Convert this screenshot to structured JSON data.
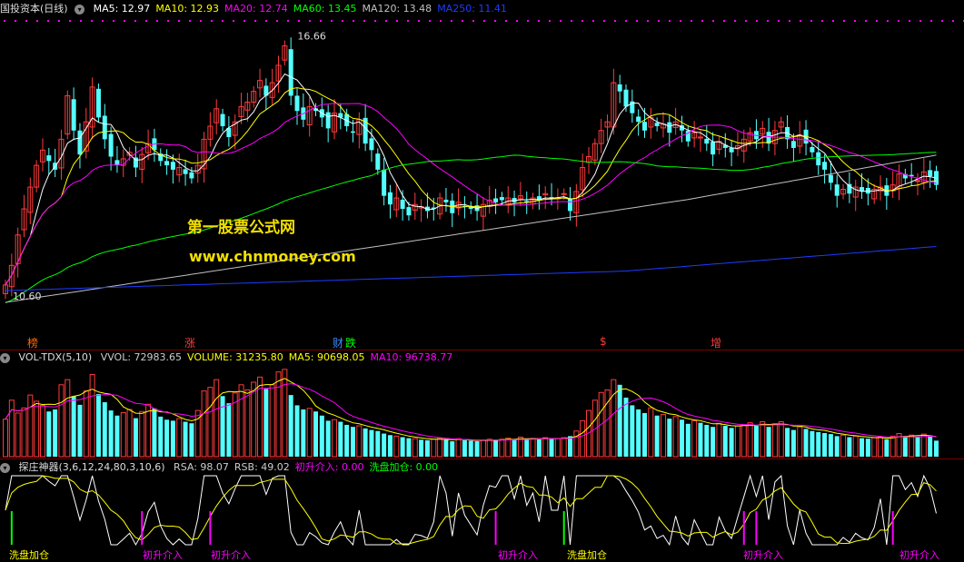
{
  "colors": {
    "bg": "#000000",
    "up": "#ff3b3b",
    "down": "#54ffff",
    "ma5": "#ffffff",
    "ma10": "#ffff00",
    "ma20": "#ff00ff",
    "ma60": "#00ff00",
    "ma120": "#c0c0c0",
    "ma250": "#1e3cff",
    "rsa": "#ffffff",
    "rsb": "#ffff00"
  },
  "price_panel": {
    "icon": "settings-icon",
    "title": "国投资本(日线)",
    "ma": [
      {
        "label": "MA5: 12.97",
        "color": "#ffffff"
      },
      {
        "label": "MA10: 12.93",
        "color": "#ffff00"
      },
      {
        "label": "MA20: 12.74",
        "color": "#ff00ff"
      },
      {
        "label": "MA60: 13.45",
        "color": "#00ff00"
      },
      {
        "label": "MA120: 13.48",
        "color": "#c0c0c0"
      },
      {
        "label": "MA250: 11.41",
        "color": "#1e3cff"
      }
    ],
    "high_label": "16.66",
    "low_label": "10.60",
    "watermark_title": "第一股票公式网",
    "watermark_url": "www.chnmoney.com",
    "event_markers": [
      {
        "text": "榜",
        "color": "#ff6a00"
      },
      {
        "text": "涨",
        "color": "#ff3b3b"
      },
      {
        "text": "财",
        "color": "#3c8cff"
      },
      {
        "text": "跌",
        "color": "#00ff00"
      },
      {
        "text": "$",
        "color": "#ff3b3b"
      },
      {
        "text": "增",
        "color": "#ff3b3b"
      }
    ]
  },
  "volume_panel": {
    "icon": "settings-icon",
    "title": "VOL-TDX(5,10)",
    "values": [
      {
        "label": "VVOL: 72983.65",
        "color": "#cccccc"
      },
      {
        "label": "VOLUME: 31235.80",
        "color": "#ffff00"
      },
      {
        "label": "MA5: 90698.05",
        "color": "#ffff00"
      },
      {
        "label": "MA10: 96738.77",
        "color": "#ff00ff"
      }
    ]
  },
  "indicator_panel": {
    "icon": "settings-icon",
    "title": "探庄神器(3,6,12,24,80,3,10,6)",
    "values": [
      {
        "label": "RSA: 98.07",
        "color": "#cccccc"
      },
      {
        "label": "RSB: 49.02",
        "color": "#cccccc"
      },
      {
        "label": "初升介入: 0.00",
        "color": "#ff00ff"
      },
      {
        "label": "洗盘加仓: 0.00",
        "color": "#00ff00"
      }
    ],
    "signal_labels": [
      {
        "text": "洗盘加仓",
        "color": "#ffff00"
      },
      {
        "text": "初升介入",
        "color": "#ff00ff"
      },
      {
        "text": "初升介入",
        "color": "#ff00ff"
      },
      {
        "text": "初升介入",
        "color": "#ff00ff"
      },
      {
        "text": "洗盘加仓",
        "color": "#ffff00"
      },
      {
        "text": "初升介入",
        "color": "#ff00ff"
      },
      {
        "text": "初升介入",
        "color": "#ff00ff"
      }
    ]
  },
  "chart_data": {
    "type": "candlestick",
    "title": "国投资本(日线)",
    "ylim": [
      10.6,
      16.66
    ],
    "series": [
      {
        "name": "MA5",
        "last": 12.97
      },
      {
        "name": "MA10",
        "last": 12.93
      },
      {
        "name": "MA20",
        "last": 12.74
      },
      {
        "name": "MA60",
        "last": 13.45
      },
      {
        "name": "MA120",
        "last": 13.48
      },
      {
        "name": "MA250",
        "last": 11.41
      }
    ],
    "close": [
      10.85,
      11.3,
      12.0,
      12.6,
      13.1,
      13.6,
      13.95,
      13.7,
      13.5,
      14.2,
      15.2,
      14.4,
      13.85,
      14.6,
      15.4,
      14.7,
      14.2,
      13.8,
      13.6,
      13.75,
      13.9,
      13.55,
      13.85,
      14.1,
      13.95,
      13.7,
      13.6,
      13.5,
      13.55,
      13.4,
      13.3,
      13.6,
      14.2,
      14.5,
      14.9,
      14.5,
      14.25,
      14.6,
      14.95,
      15.05,
      15.3,
      15.55,
      15.2,
      15.5,
      15.9,
      16.35,
      15.2,
      14.85,
      14.65,
      14.95,
      14.85,
      14.7,
      14.45,
      14.8,
      14.7,
      14.5,
      14.35,
      14.65,
      14.1,
      13.95,
      13.5,
      12.9,
      12.7,
      12.85,
      12.6,
      12.45,
      12.7,
      12.65,
      12.55,
      12.6,
      12.85,
      12.75,
      12.5,
      12.75,
      12.65,
      12.6,
      12.55,
      12.7,
      12.8,
      12.75,
      12.8,
      12.85,
      12.75,
      12.9,
      12.75,
      12.85,
      12.8,
      12.95,
      12.85,
      12.85,
      12.95,
      12.55,
      13.0,
      13.55,
      13.8,
      14.1,
      14.4,
      14.6,
      15.5,
      15.3,
      14.95,
      14.8,
      14.6,
      14.4,
      14.7,
      14.5,
      14.55,
      14.35,
      14.6,
      14.4,
      14.15,
      14.35,
      14.25,
      14.1,
      13.85,
      14.15,
      14.0,
      13.9,
      14.05,
      14.2,
      14.35,
      14.2,
      14.45,
      14.1,
      14.4,
      14.6,
      14.2,
      14.0,
      14.3,
      14.1,
      13.9,
      13.6,
      13.5,
      13.2,
      12.9,
      13.05,
      12.95,
      13.1,
      13.0,
      12.95,
      13.05,
      13.1,
      12.9,
      13.15,
      13.4,
      13.3,
      13.35,
      13.25,
      13.45,
      13.35,
      13.15
    ],
    "volume": [
      72983.65,
      110000,
      85000,
      95000,
      120000,
      108000,
      100000,
      88000,
      92000,
      140000,
      150000,
      118000,
      101000,
      128000,
      160000,
      122000,
      106000,
      90000,
      80000,
      86000,
      92000,
      75000,
      88000,
      102000,
      94000,
      78000,
      72000,
      70000,
      74000,
      68000,
      65000,
      90000,
      128000,
      135000,
      150000,
      118000,
      104000,
      124000,
      140000,
      130000,
      145000,
      155000,
      132000,
      140000,
      165000,
      170000,
      120000,
      100000,
      92000,
      94000,
      88000,
      80000,
      70000,
      72000,
      68000,
      62000,
      58000,
      60000,
      55000,
      52000,
      50000,
      45000,
      42000,
      40000,
      38000,
      36000,
      35000,
      33000,
      32000,
      34000,
      36000,
      33000,
      30000,
      35000,
      32000,
      31000,
      30000,
      32000,
      34000,
      33000,
      34000,
      36000,
      34000,
      38000,
      33000,
      35000,
      34000,
      37000,
      36000,
      35000,
      37000,
      40000,
      50000,
      70000,
      90000,
      110000,
      125000,
      130000,
      150000,
      140000,
      115000,
      100000,
      92000,
      85000,
      95000,
      80000,
      82000,
      74000,
      78000,
      72000,
      64000,
      70000,
      66000,
      62000,
      58000,
      65000,
      60000,
      56000,
      60000,
      62000,
      66000,
      60000,
      68000,
      58000,
      64000,
      68000,
      56000,
      52000,
      58000,
      54000,
      50000,
      48000,
      46000,
      44000,
      40000,
      42000,
      38000,
      40000,
      36000,
      35000,
      37000,
      38000,
      34000,
      40000,
      45000,
      40000,
      42000,
      38000,
      44000,
      40000,
      31235.8
    ]
  }
}
